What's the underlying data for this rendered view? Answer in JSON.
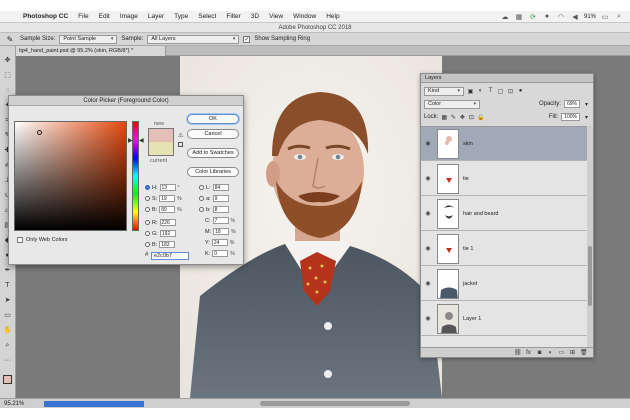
{
  "menubar": {
    "apple_icon": "apple-icon",
    "items": [
      {
        "label": "Photoshop CC"
      },
      {
        "label": "File"
      },
      {
        "label": "Edit"
      },
      {
        "label": "Image"
      },
      {
        "label": "Layer"
      },
      {
        "label": "Type"
      },
      {
        "label": "Select"
      },
      {
        "label": "Filter"
      },
      {
        "label": "3D"
      },
      {
        "label": "View"
      },
      {
        "label": "Window"
      },
      {
        "label": "Help"
      }
    ],
    "battery": "91%"
  },
  "window_title": "Adobe Photoshop CC 2018",
  "options_bar": {
    "sample_size_label": "Sample Size:",
    "sample_size_value": "Point Sample",
    "sample_label": "Sample:",
    "sample_value": "All Layers",
    "show_ring_label": "Show Sampling Ring",
    "show_ring_checked": true
  },
  "document": {
    "tab_label": "tip4_hand_paint.psd @ 95.2% (skin, RGB/8*) *"
  },
  "color_picker": {
    "title": "Color Picker (Foreground Color)",
    "new_label": "new",
    "current_label": "current",
    "new_color": "#e2c0b7",
    "current_color": "#e6e2b2",
    "buttons": {
      "ok": "OK",
      "cancel": "Cancel",
      "add_swatches": "Add to Swatches",
      "color_libraries": "Color Libraries"
    },
    "values": {
      "h": {
        "label": "H:",
        "value": "13",
        "unit": "°"
      },
      "s": {
        "label": "S:",
        "value": "19",
        "unit": "%"
      },
      "b": {
        "label": "B:",
        "value": "89",
        "unit": "%"
      },
      "r": {
        "label": "R:",
        "value": "226",
        "unit": ""
      },
      "g": {
        "label": "G:",
        "value": "192",
        "unit": ""
      },
      "bb": {
        "label": "B:",
        "value": "183",
        "unit": ""
      },
      "l": {
        "label": "L:",
        "value": "84",
        "unit": ""
      },
      "a": {
        "label": "a:",
        "value": "9",
        "unit": ""
      },
      "lab_b": {
        "label": "b:",
        "value": "8",
        "unit": ""
      },
      "c": {
        "label": "C:",
        "value": "7",
        "unit": "%"
      },
      "m": {
        "label": "M:",
        "value": "18",
        "unit": "%"
      },
      "y": {
        "label": "Y:",
        "value": "24",
        "unit": "%"
      },
      "k": {
        "label": "K:",
        "value": "0",
        "unit": "%"
      }
    },
    "hex_label": "#",
    "hex_value": "e2c0b7",
    "only_web_colors": "Only Web Colors"
  },
  "layers_panel": {
    "title": "Layers",
    "kind_value": "Kind",
    "blend_mode": "Color",
    "opacity_label": "Opacity:",
    "opacity_value": "69%",
    "lock_label": "Lock:",
    "fill_label": "Fill:",
    "fill_value": "100%",
    "layers": [
      {
        "name": "skin",
        "active": true
      },
      {
        "name": "tie",
        "active": false
      },
      {
        "name": "hair and beard",
        "active": false
      },
      {
        "name": "tie 1",
        "active": false
      },
      {
        "name": "jacket",
        "active": false
      },
      {
        "name": "Layer 1",
        "active": false
      }
    ]
  },
  "status_bar": {
    "zoom": "95.21%"
  }
}
